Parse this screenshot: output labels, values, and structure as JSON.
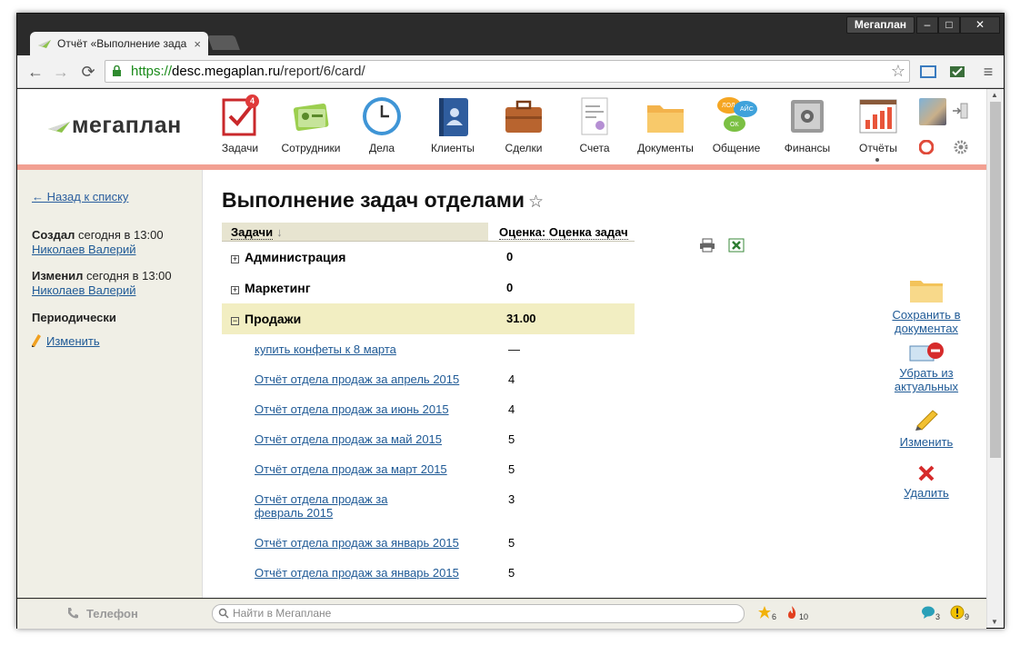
{
  "browser": {
    "profile_label": "Мегаплан",
    "tab_title": "Отчёт «Выполнение зада",
    "tab_close": "×",
    "url_scheme": "https://",
    "url_host": "desc.megaplan.ru",
    "url_path": "/report/6/card/"
  },
  "header": {
    "logo_text": "мегаплан",
    "nav": [
      {
        "label": "Задачи",
        "icon": "tasks-icon",
        "badge": "4"
      },
      {
        "label": "Сотрудники",
        "icon": "employees-icon"
      },
      {
        "label": "Дела",
        "icon": "clock-icon"
      },
      {
        "label": "Клиенты",
        "icon": "clients-icon"
      },
      {
        "label": "Сделки",
        "icon": "briefcase-icon"
      },
      {
        "label": "Счета",
        "icon": "invoice-icon"
      },
      {
        "label": "Документы",
        "icon": "folder-icon"
      },
      {
        "label": "Общение",
        "icon": "chat-icon",
        "bubbles": [
          "ЛОЛ",
          "АЙС",
          "ОК"
        ]
      },
      {
        "label": "Финансы",
        "icon": "safe-icon"
      },
      {
        "label": "Отчёты",
        "icon": "report-chart-icon",
        "active": true
      }
    ]
  },
  "sidebar": {
    "back_label": "← Назад к списку",
    "created_label": "Создал",
    "created_when": " сегодня в 13:00",
    "created_by": "Николаев Валерий",
    "changed_label": "Изменил",
    "changed_when": " сегодня в 13:00",
    "changed_by": "Николаев Валерий",
    "periodic_label": "Периодически",
    "edit_label": "Изменить"
  },
  "main": {
    "title": "Выполнение задач отделами",
    "star": "☆",
    "col_task": "Задачи",
    "sort_arrow": "↓",
    "col_score": "Оценка: Оценка задач",
    "groups": [
      {
        "name": "Администрация",
        "value": "0",
        "toggle": "+"
      },
      {
        "name": "Маркетинг",
        "value": "0",
        "toggle": "+"
      },
      {
        "name": "Продажи",
        "value": "31.00",
        "toggle": "−"
      }
    ],
    "tasks": [
      {
        "name": "купить конфеты к 8 марта",
        "value": "—"
      },
      {
        "name": "Отчёт отдела продаж за апрель 2015",
        "value": "4"
      },
      {
        "name": "Отчёт отдела продаж за июнь 2015",
        "value": "4"
      },
      {
        "name": "Отчёт отдела продаж за май 2015",
        "value": "5"
      },
      {
        "name": "Отчёт отдела продаж за март 2015",
        "value": "5"
      },
      {
        "name": "Отчёт отдела продаж за февраль 2015",
        "value": "3"
      },
      {
        "name": "Отчёт отдела продаж за январь 2015",
        "value": "5"
      },
      {
        "name": "Отчёт отдела продаж за январь 2015",
        "value": "5"
      }
    ],
    "actions": {
      "save": "Сохранить в документах",
      "remove": "Убрать из актуальных",
      "edit": "Изменить",
      "delete": "Удалить"
    }
  },
  "statusbar": {
    "phone_label": "Телефон",
    "search_placeholder": "Найти в Мегаплане",
    "stars_count": "6",
    "fire_count": "10",
    "messages_count": "3",
    "warnings_count": "9"
  },
  "colors": {
    "accent_bar": "#f2a092",
    "link": "#1f5a96",
    "open_group_bg": "#f2eec2",
    "badge": "#e03a3a"
  }
}
